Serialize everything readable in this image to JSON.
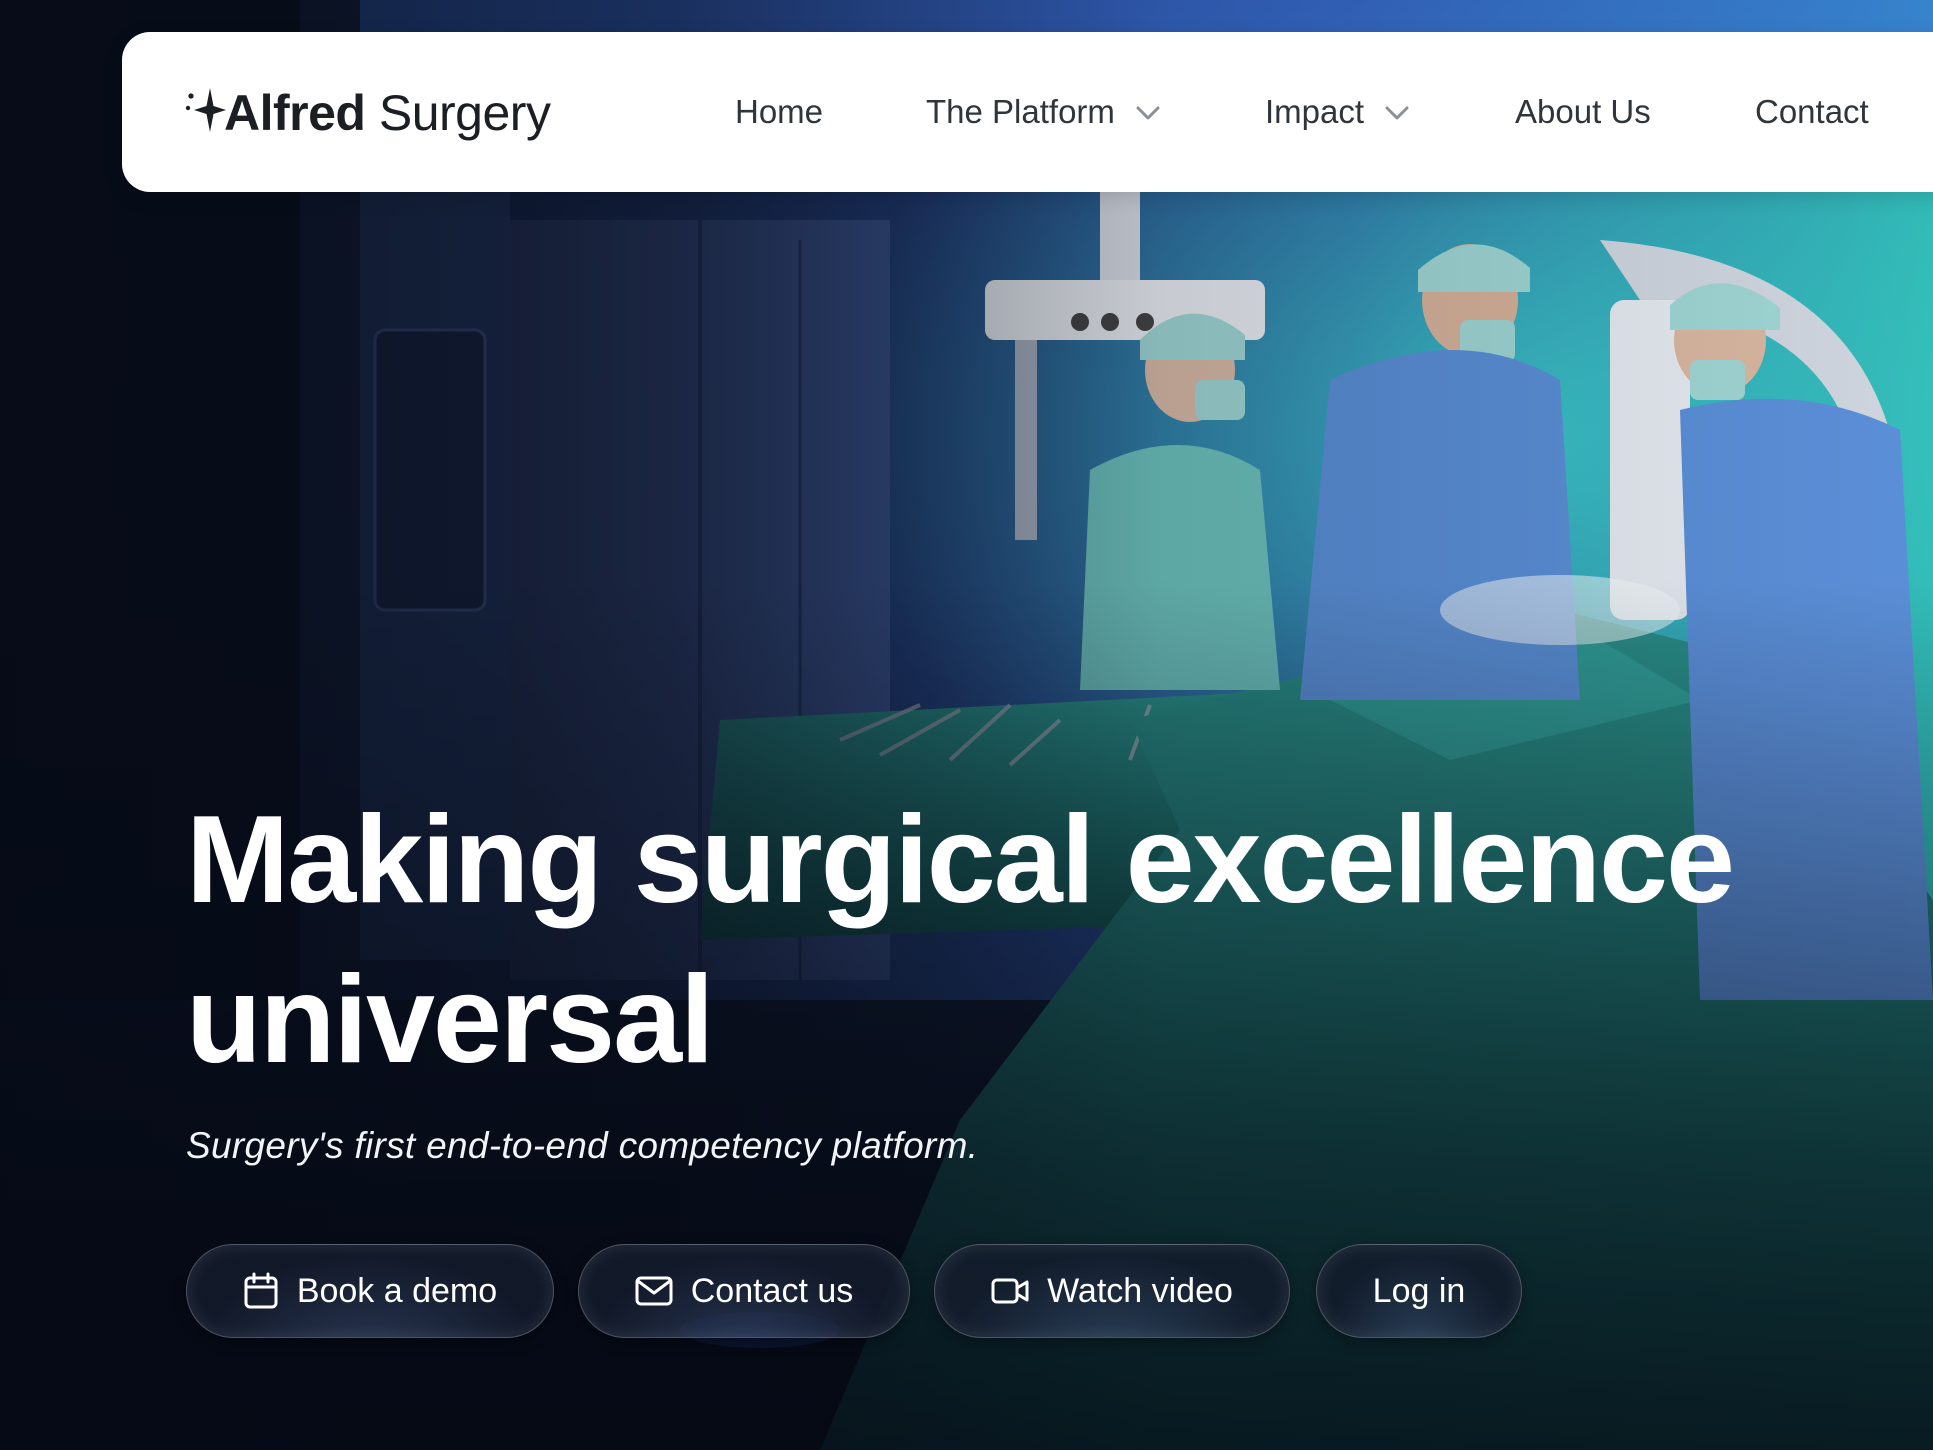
{
  "brand": {
    "name_bold": "Alfred",
    "name_light": "Surgery"
  },
  "nav": {
    "items": [
      {
        "label": "Home",
        "has_dropdown": false
      },
      {
        "label": "The Platform",
        "has_dropdown": true
      },
      {
        "label": "Impact",
        "has_dropdown": true
      },
      {
        "label": "About Us",
        "has_dropdown": false
      },
      {
        "label": "Contact",
        "has_dropdown": false
      }
    ]
  },
  "hero": {
    "headline_line1": "Making surgical excellence",
    "headline_line2": "universal",
    "subheadline": "Surgery's first end-to-end competency platform.",
    "background": "operating-room-photo"
  },
  "cta": {
    "book_demo": {
      "label": "Book a demo",
      "icon": "calendar-icon"
    },
    "contact_us": {
      "label": "Contact us",
      "icon": "mail-icon"
    },
    "watch_video": {
      "label": "Watch video",
      "icon": "video-camera-icon"
    },
    "log_in": {
      "label": "Log in"
    }
  },
  "colors": {
    "nav_bg": "#ffffff",
    "nav_text": "#2f353b",
    "headline": "#ffffff",
    "surgical_drape": "#1f7a76",
    "scrubs_blue": "#5a8fd6"
  }
}
